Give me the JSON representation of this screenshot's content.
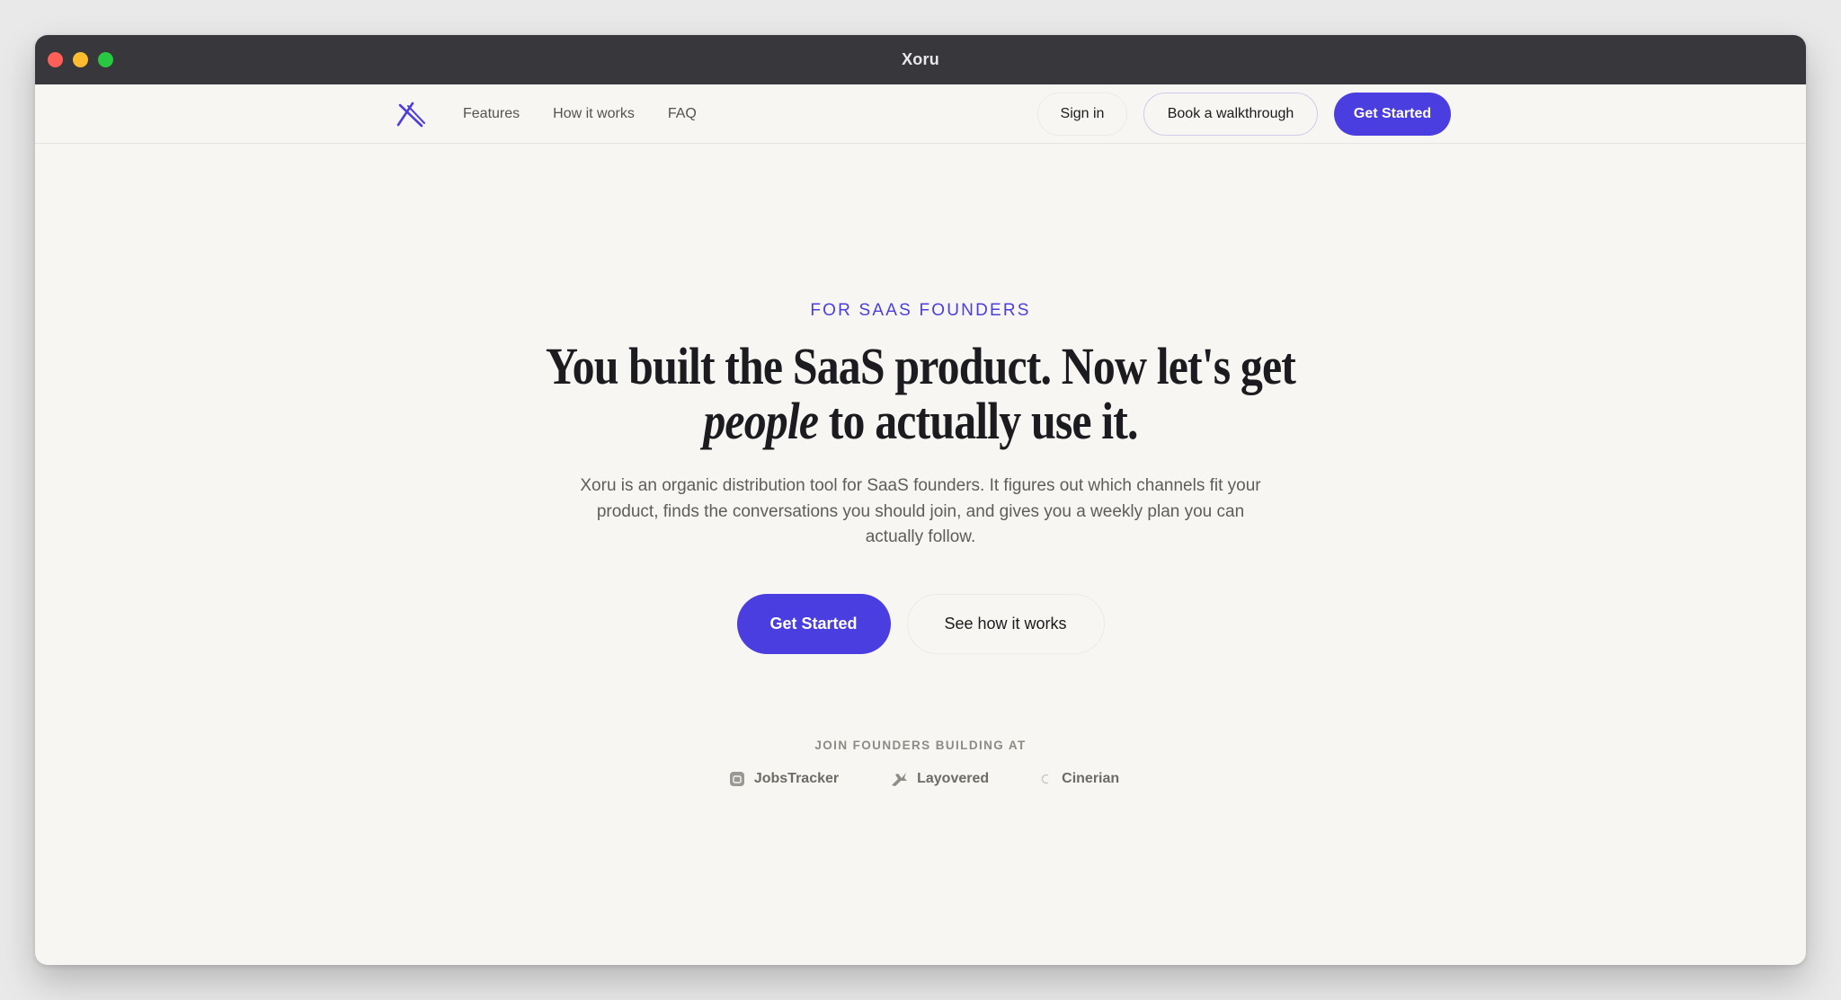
{
  "window": {
    "title": "Xoru"
  },
  "nav": {
    "logo_icon": "xoru-logo-icon",
    "links": [
      "Features",
      "How it works",
      "FAQ"
    ],
    "sign_in_label": "Sign in",
    "walkthrough_label": "Book a walkthrough",
    "get_started_label": "Get Started"
  },
  "hero": {
    "eyebrow": "FOR SAAS FOUNDERS",
    "headline_before": "You built the SaaS product. Now let's get ",
    "headline_emphasis": "people",
    "headline_after": " to actually use it.",
    "subtext": "Xoru is an organic distribution tool for SaaS founders. It figures out which channels fit your product, finds the conversations you should join, and gives you a weekly plan you can actually follow.",
    "primary_cta": "Get Started",
    "secondary_cta": "See how it works"
  },
  "social_proof": {
    "label": "JOIN FOUNDERS BUILDING AT",
    "companies": [
      {
        "name": "JobsTracker",
        "icon": "jobstracker-logo-icon"
      },
      {
        "name": "Layovered",
        "icon": "layovered-logo-icon"
      },
      {
        "name": "Cinerian",
        "icon": "cinerian-logo-icon"
      }
    ]
  },
  "colors": {
    "accent": "#4a3ee0",
    "background": "#f7f6f2",
    "titlebar": "#38373b"
  }
}
